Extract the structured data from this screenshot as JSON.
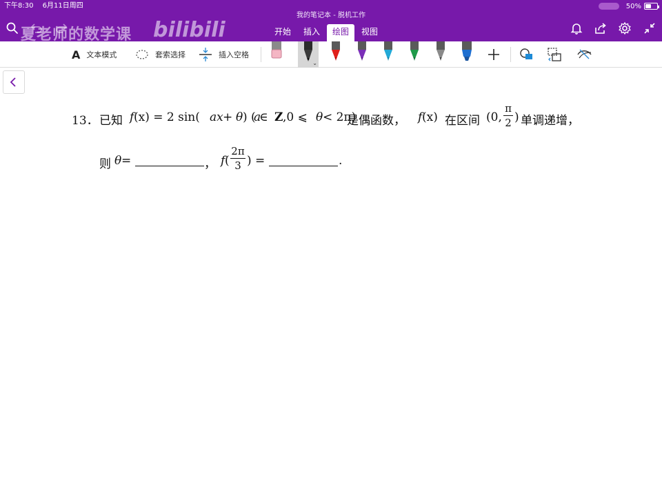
{
  "status_bar": {
    "time": "下午8:30",
    "date": "6月11日周四",
    "battery": "50%"
  },
  "document_title": "我的笔记本 - 脱机工作",
  "watermark": {
    "text": "夏老师的数学课",
    "logo": "bilibili"
  },
  "tabs": [
    {
      "label": "开始",
      "active": false
    },
    {
      "label": "插入",
      "active": false
    },
    {
      "label": "绘图",
      "active": true
    },
    {
      "label": "视图",
      "active": false
    }
  ],
  "toolbar": {
    "text_mode_label": "文本模式",
    "lasso_label": "套索选择",
    "insert_space_label": "插入空格",
    "pens": [
      {
        "name": "eraser",
        "color": "#f4b6c4"
      },
      {
        "name": "pen-black",
        "color": "#1f1f1f"
      },
      {
        "name": "pen-red",
        "color": "#e0201b"
      },
      {
        "name": "pen-purple",
        "color": "#7b2fb8"
      },
      {
        "name": "pen-cyan",
        "color": "#23a9d6"
      },
      {
        "name": "pen-green",
        "color": "#1f9a4a"
      },
      {
        "name": "pencil-gray",
        "color": "#6a6a6a"
      },
      {
        "name": "highlighter-blue",
        "color": "#1e6fd0"
      }
    ]
  },
  "colors": {
    "header": "#7719AA",
    "accent": "#7719AA"
  },
  "question": {
    "number": "13．",
    "line1": {
      "t1": "已知",
      "f1": "f",
      "t2": " (x) = 2 sin(",
      "f2": "ax",
      "t3": " + ",
      "f3": "θ",
      "t4": ")  (",
      "f4": "a",
      "t5": " ∈ ",
      "t5b": "Z",
      "t6": ",0 ⩽ ",
      "f5": "θ",
      "t7": " < 2π)",
      "t8": "是偶函数，",
      "f6": "f",
      "t9": " (x)",
      "t10": "在区间",
      "t11": "(0,",
      "frac_num": "π",
      "frac_den": "2",
      "t12": ")",
      "t13": "单调递增，"
    },
    "line2": {
      "t1": "则",
      "f1": "θ",
      "t2": " =",
      "t3": "，",
      "f2": "f",
      "t4": "(",
      "frac_num": "2π",
      "frac_den": "3",
      "t5": ") =",
      "t6": "."
    }
  }
}
